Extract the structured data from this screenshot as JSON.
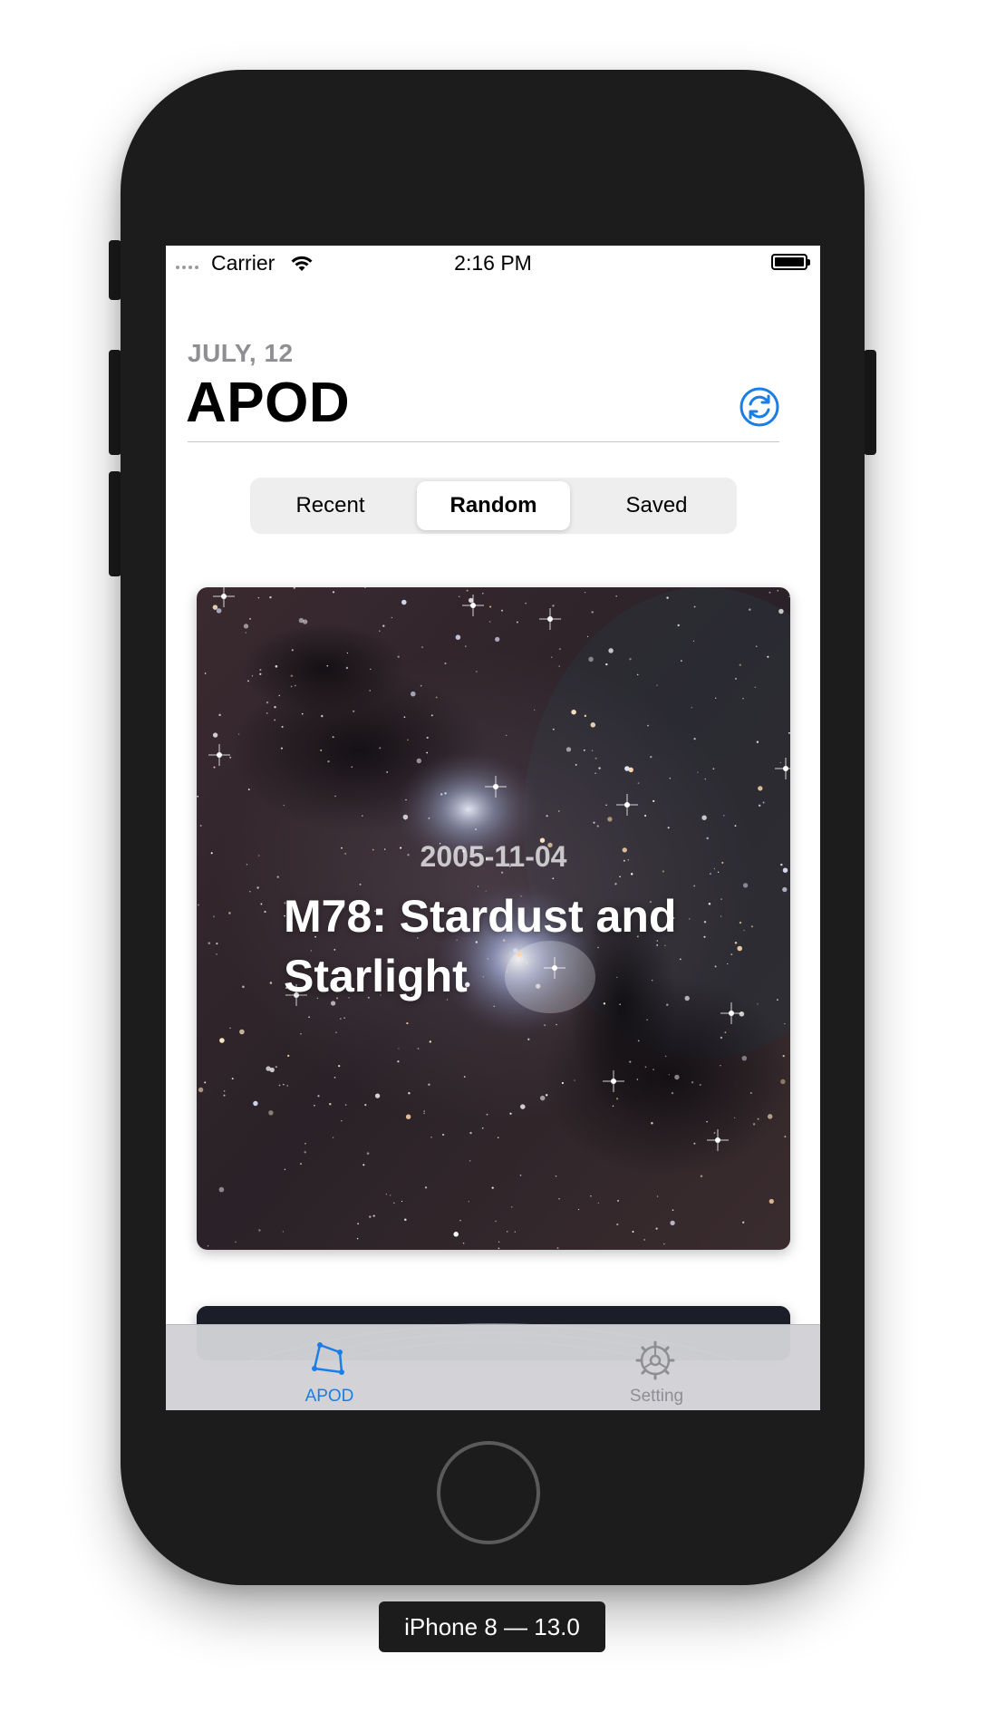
{
  "status_bar": {
    "carrier": "Carrier",
    "time": "2:16 PM"
  },
  "header": {
    "date": "JULY, 12",
    "title": "APOD",
    "refresh_icon": "refresh-icon"
  },
  "segmented_control": {
    "segments": [
      "Recent",
      "Random",
      "Saved"
    ],
    "selected": "Random"
  },
  "card": {
    "date": "2005-11-04",
    "title": "M78: Stardust and Starlight"
  },
  "tab_bar": {
    "items": [
      {
        "label": "APOD",
        "icon": "apod-icon",
        "active": true
      },
      {
        "label": "Setting",
        "icon": "gear-icon",
        "active": false
      }
    ]
  },
  "device_label": "iPhone 8 — 13.0",
  "colors": {
    "accent": "#1a7ee6",
    "inactive": "#8e8e93",
    "frame": "#1c1c1c"
  }
}
